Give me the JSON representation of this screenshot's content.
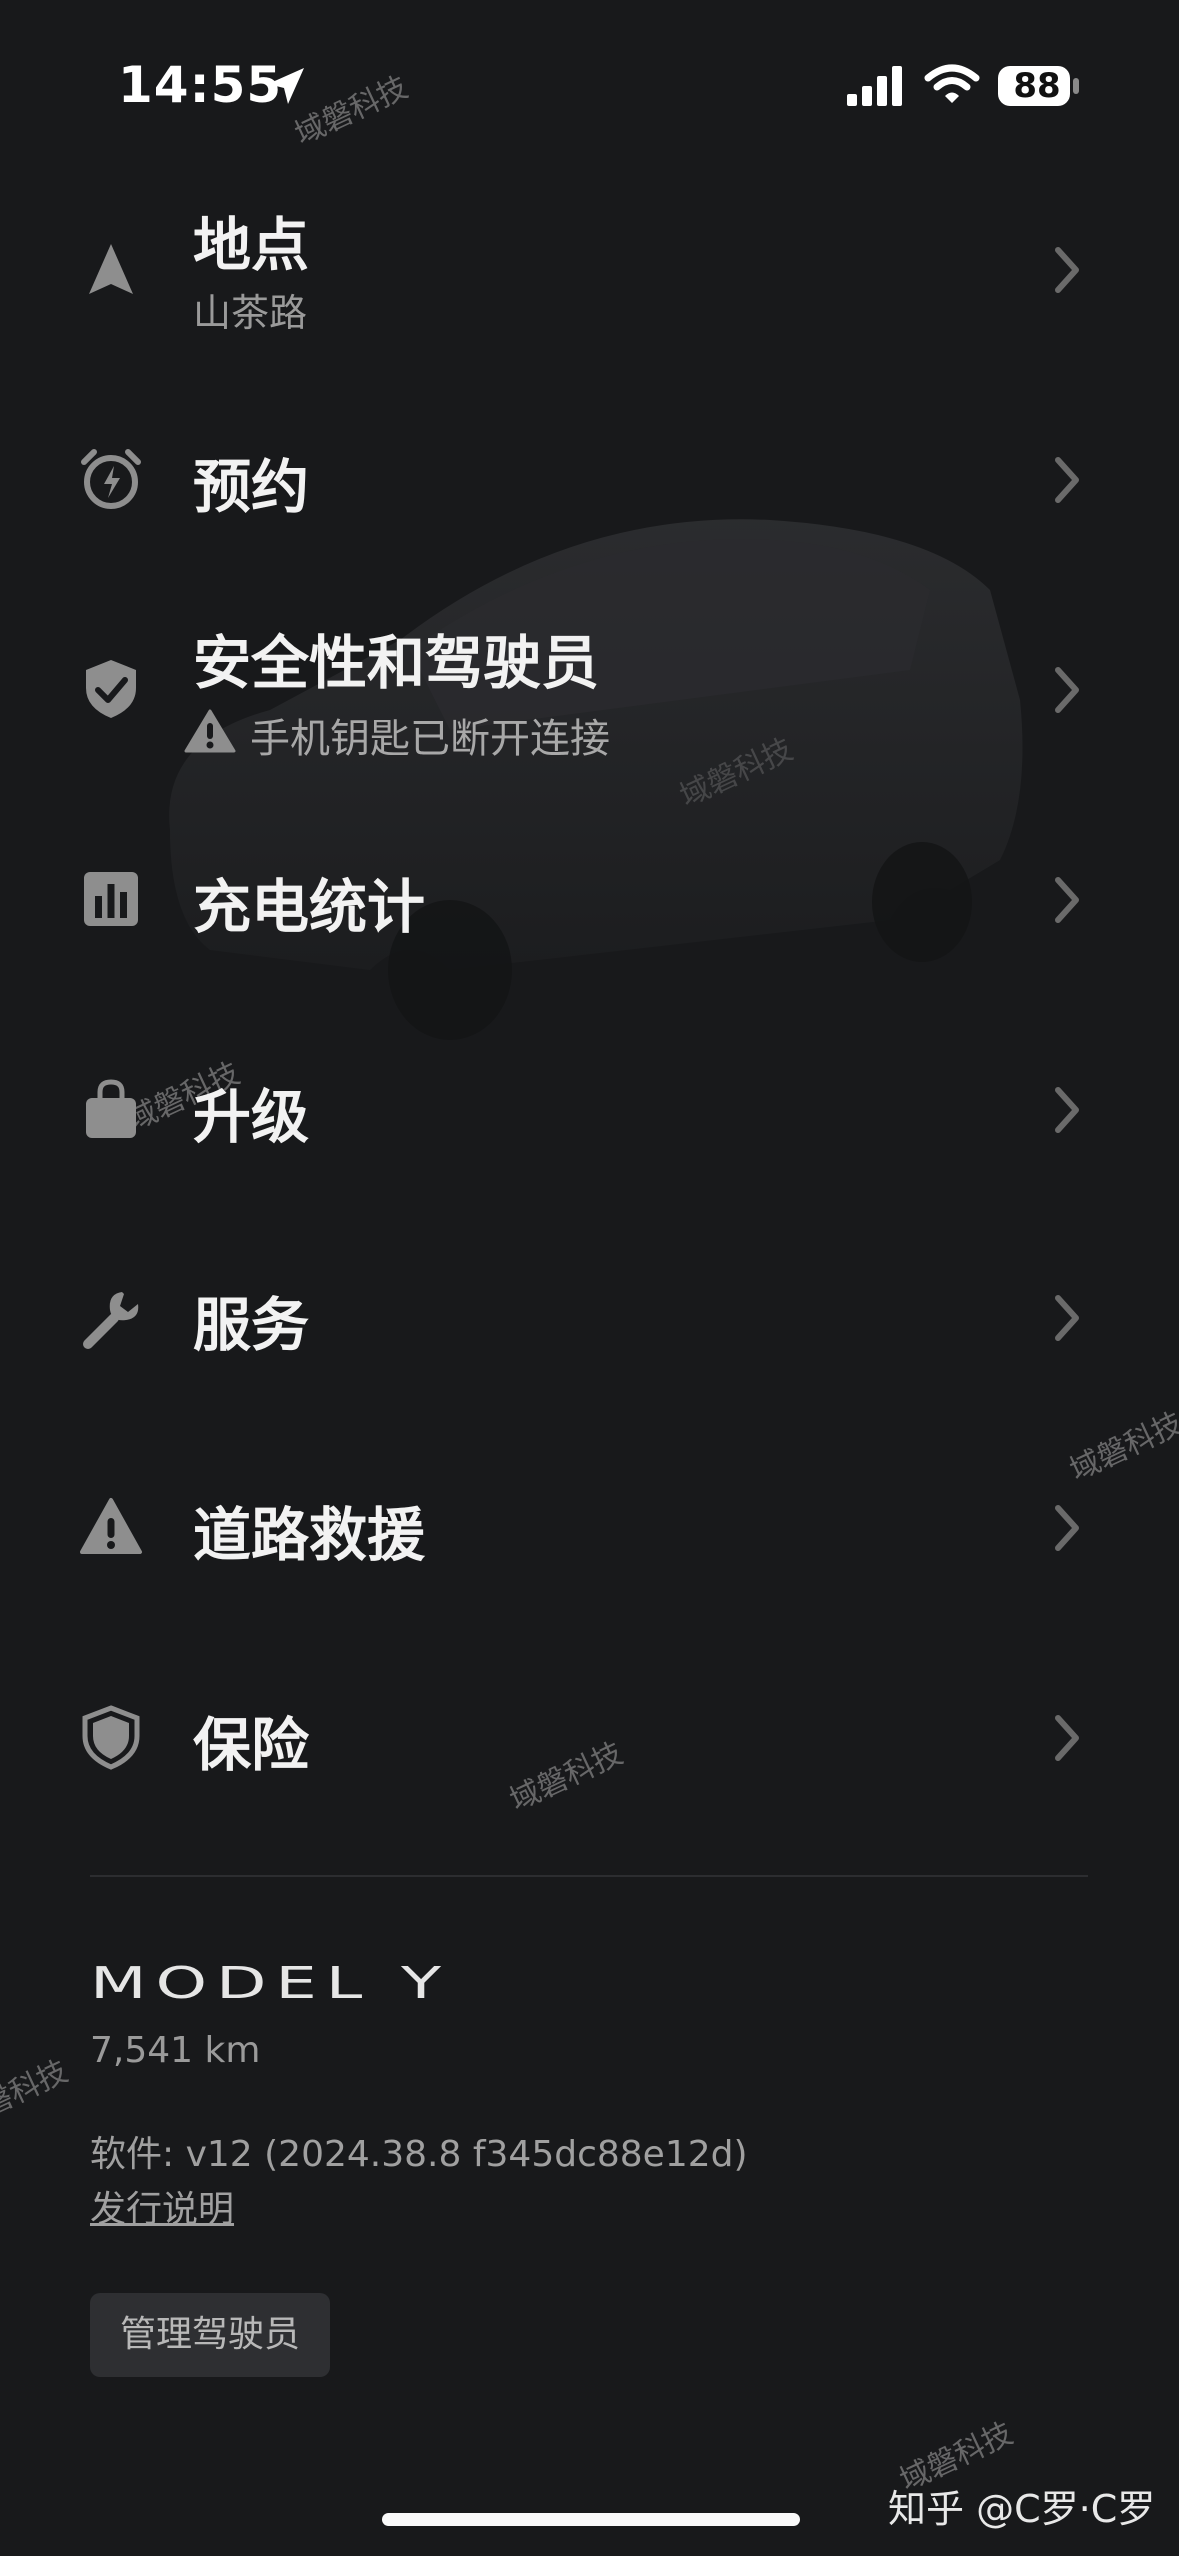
{
  "status_bar": {
    "time": "14:55",
    "battery": "88"
  },
  "menu": [
    {
      "title": "地点",
      "subtitle": "山茶路",
      "icon": "navigation-arrow-icon"
    },
    {
      "title": "预约",
      "icon": "alarm-clock-bolt-icon"
    },
    {
      "title": "安全性和驾驶员",
      "warning": "手机钥匙已断开连接",
      "icon": "shield-check-icon"
    },
    {
      "title": "充电统计",
      "icon": "bar-chart-icon"
    },
    {
      "title": "升级",
      "icon": "shopping-bag-icon"
    },
    {
      "title": "服务",
      "icon": "wrench-icon"
    },
    {
      "title": "道路救援",
      "icon": "warning-triangle-icon"
    },
    {
      "title": "保险",
      "icon": "shield-icon"
    }
  ],
  "vehicle": {
    "model": "MODEL Y",
    "odometer": "7,541 km",
    "software": "软件: v12 (2024.38.8 f345dc88e12d)",
    "release_notes": "发行说明",
    "manage_drivers": "管理驾驶员"
  },
  "watermark": "域磐科技",
  "credit": "知乎 @C罗·C罗",
  "colors": {
    "background": "#18191b",
    "text": "#f2f2f2",
    "muted": "#9a9a9a",
    "icon": "#8e8e8e",
    "button": "#2e2f32"
  }
}
